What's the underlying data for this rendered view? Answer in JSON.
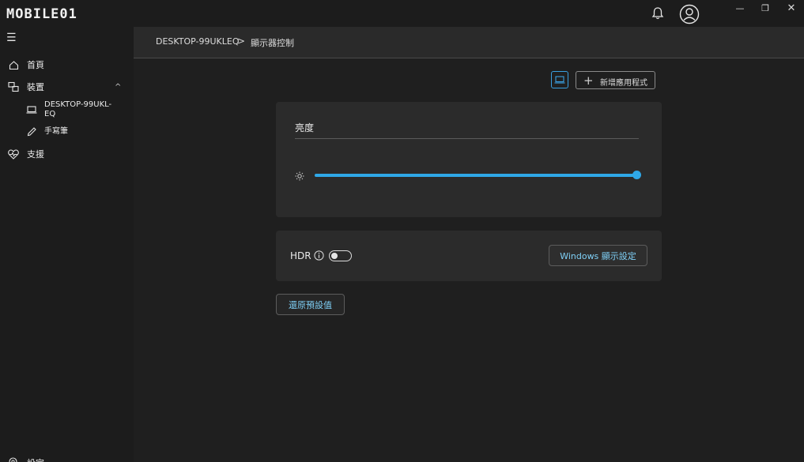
{
  "app": {
    "logo_text": "MOBILE01"
  },
  "window": {
    "minimize": "—",
    "maximize": "❐",
    "close": "✕"
  },
  "sidebar": {
    "items": [
      {
        "label": "首頁",
        "icon": "home-icon"
      },
      {
        "label": "裝置",
        "icon": "devices-icon"
      },
      {
        "label": "支援",
        "icon": "support-heart-icon"
      }
    ],
    "devices": [
      {
        "label": "DESKTOP-99UKL-EQ",
        "icon": "laptop-icon"
      },
      {
        "label": "手寫筆",
        "icon": "pen-icon"
      }
    ],
    "settings_label": "設定"
  },
  "breadcrumb": {
    "item1": "DESKTOP-99UKLEQ",
    "separator": ">",
    "item2": "顯示器控制"
  },
  "toolbar": {
    "add_app_label": "新增應用程式"
  },
  "brightness": {
    "title": "亮度",
    "value_percent": 100
  },
  "hdr": {
    "label": "HDR",
    "enabled": false,
    "windows_display_label": "Windows 顯示設定"
  },
  "restore_label": "還原預設值",
  "colors": {
    "accent": "#2fa8e8",
    "link": "#7fd0f7",
    "background": "#1f1f1f",
    "card": "#2b2b2b"
  }
}
